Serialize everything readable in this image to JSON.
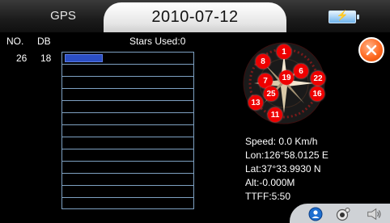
{
  "header": {
    "app_tab": "GPS",
    "date": "2010-07-12",
    "battery_icon": "battery-charging-icon"
  },
  "table": {
    "col_no": "NO.",
    "col_db": "DB",
    "stars_used": "Stars Used:0",
    "rows": [
      {
        "no": "26",
        "db": "18",
        "signal": 18
      }
    ],
    "bar_scale_max": 60,
    "row_count": 13
  },
  "satellites": [
    "1",
    "8",
    "7",
    "19",
    "6",
    "22",
    "25",
    "16",
    "13",
    "11"
  ],
  "status": {
    "speed": "Speed: 0.0 Km/h",
    "lon": "Lon:126°58.0125 E",
    "lat": "Lat:37°33.9930 N",
    "alt": "Alt:-0.000M",
    "ttff": "TTFF:5:50"
  },
  "controls": {
    "close_icon": "close-icon",
    "bottom_icons": [
      "user-icon",
      "camera-icon",
      "speaker-icon"
    ]
  },
  "colors": {
    "accent_orange": "#ff6a21",
    "signal_bar": "#2b4fc4",
    "grid_line": "#7ea1c2",
    "satellite_red": "#e00000"
  }
}
